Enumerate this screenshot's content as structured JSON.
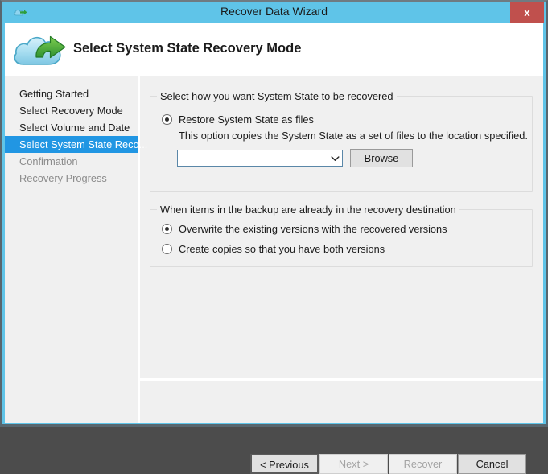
{
  "window": {
    "title": "Recover Data Wizard",
    "title_icon": "cloud-icon",
    "close_label": "x",
    "titlebar_color": "#5fc4e8",
    "close_color": "#c0504d"
  },
  "header": {
    "title": "Select System State Recovery Mode",
    "icon": "cloud-restore-icon"
  },
  "sidebar": {
    "items": [
      {
        "label": "Getting Started",
        "state": "done"
      },
      {
        "label": "Select Recovery Mode",
        "state": "done"
      },
      {
        "label": "Select Volume and Date",
        "state": "done"
      },
      {
        "label": "Select System State Reco...",
        "state": "selected"
      },
      {
        "label": "Confirmation",
        "state": "disabled"
      },
      {
        "label": "Recovery Progress",
        "state": "disabled"
      }
    ],
    "selected_color": "#2196e3"
  },
  "main": {
    "group1": {
      "legend": "Select how you want System State to be recovered",
      "option": {
        "label": "Restore System State as files",
        "checked": true
      },
      "description": "This option copies the System State as a set of files to the location specified.",
      "path_input": {
        "value": "",
        "placeholder": ""
      },
      "browse_label": "Browse"
    },
    "group2": {
      "legend": "When items in the backup are already in the recovery destination",
      "options": [
        {
          "label": "Overwrite the existing versions with the recovered versions",
          "checked": true
        },
        {
          "label": "Create copies so that you have both versions",
          "checked": false
        }
      ]
    }
  },
  "footer": {
    "buttons": [
      {
        "label": "< Previous",
        "enabled": true,
        "default": true
      },
      {
        "label": "Next >",
        "enabled": false,
        "default": false
      },
      {
        "label": "Recover",
        "enabled": false,
        "default": false
      },
      {
        "label": "Cancel",
        "enabled": true,
        "default": false
      }
    ]
  }
}
